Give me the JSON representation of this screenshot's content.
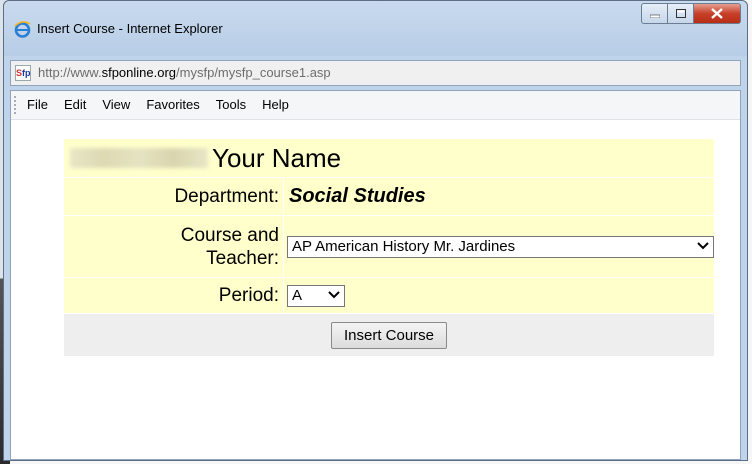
{
  "window": {
    "title": "Insert Course - Internet Explorer",
    "icon": "ie-icon",
    "controls": [
      "minimize-icon",
      "maximize-icon",
      "close-icon"
    ]
  },
  "address_bar": {
    "prefix": "http://www.",
    "domain": "sfponline.org",
    "path": "/mysfp/mysfp_course1.asp",
    "site_icon": "sfp-favicon"
  },
  "menu": {
    "items": [
      "File",
      "Edit",
      "View",
      "Favorites",
      "Tools",
      "Help"
    ]
  },
  "form": {
    "name_label": "Your Name",
    "department_label": "Department:",
    "department_value": "Social Studies",
    "course_label_line1": "Course and",
    "course_label_line2": "Teacher:",
    "course_selected": "AP American History Mr. Jardines",
    "period_label": "Period:",
    "period_selected": "A",
    "submit_label": "Insert Course"
  },
  "colors": {
    "form_row_bg": "#ffffcc",
    "button_row_bg": "#eeeeee",
    "titlebar_bg": "#c9daee",
    "close_button": "#c7402a"
  }
}
